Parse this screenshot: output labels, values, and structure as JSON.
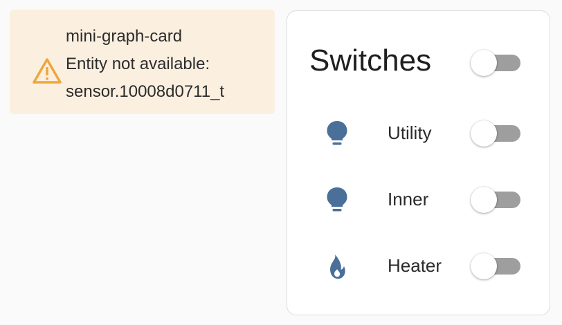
{
  "warning": {
    "line1": "mini-graph-card",
    "line2": "Entity not available:",
    "line3": "sensor.10008d0711_t",
    "icon": "alert-triangle-icon",
    "icon_color": "#f0a63a",
    "background": "#fbefe0"
  },
  "switches_card": {
    "title": "Switches",
    "master_toggle": {
      "state": "off"
    },
    "icon_color": "#4a6f98",
    "rows": [
      {
        "label": "Utility",
        "icon": "lightbulb-icon",
        "state": "off"
      },
      {
        "label": "Inner",
        "icon": "lightbulb-icon",
        "state": "off"
      },
      {
        "label": "Heater",
        "icon": "fire-icon",
        "state": "off"
      }
    ]
  }
}
